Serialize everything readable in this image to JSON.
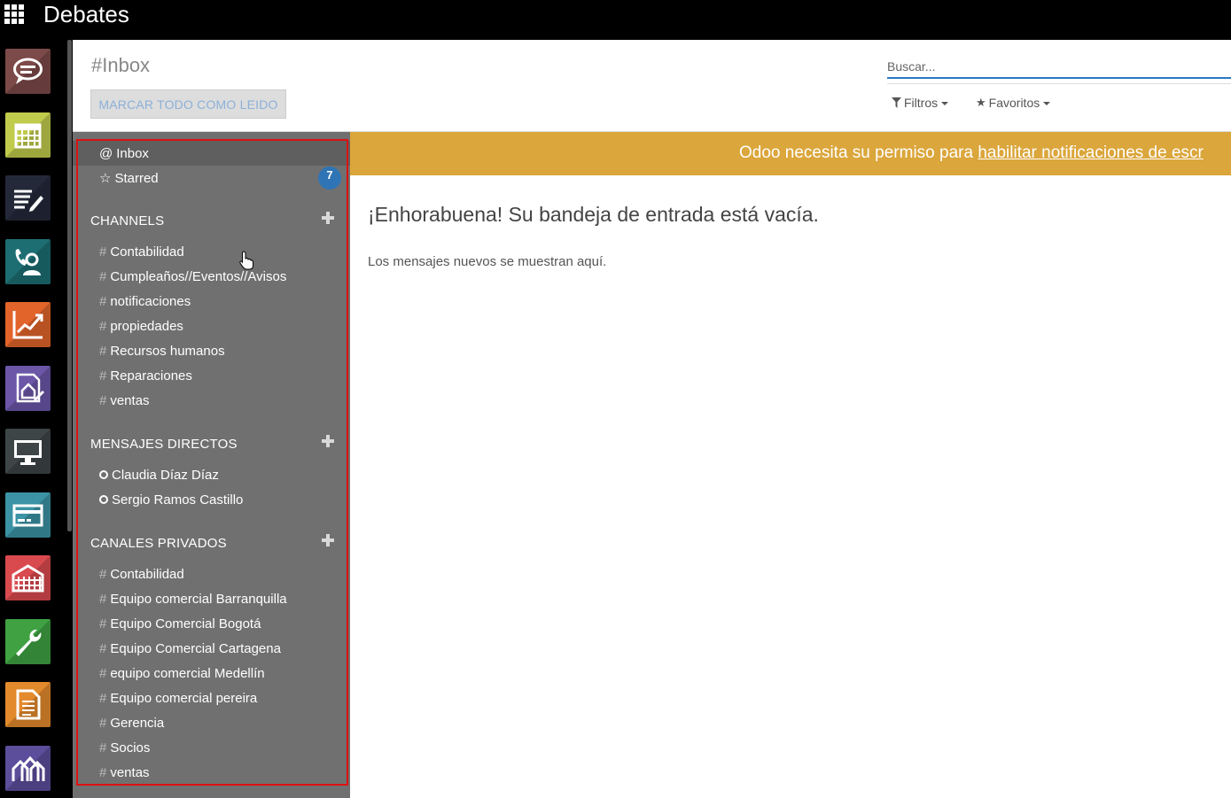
{
  "topbar": {
    "title": "Debates"
  },
  "rail": {
    "apps": [
      {
        "name": "discuss-app",
        "color": "#7c4a48",
        "icon": "chat-bubble-icon"
      },
      {
        "name": "calendar-app",
        "color": "#c1cb4c",
        "icon": "calendar-icon"
      },
      {
        "name": "notes-app",
        "color": "#24293a",
        "icon": "notes-edit-icon"
      },
      {
        "name": "contacts-app",
        "color": "#1d6e73",
        "icon": "contact-phone-icon"
      },
      {
        "name": "crm-app",
        "color": "#e2642b",
        "icon": "trend-chart-icon"
      },
      {
        "name": "property-app",
        "color": "#6b56a8",
        "icon": "house-edit-icon"
      },
      {
        "name": "website-app",
        "color": "#3e4546",
        "icon": "monitor-icon"
      },
      {
        "name": "payments-app",
        "color": "#3c93a5",
        "icon": "credit-card-icon"
      },
      {
        "name": "inventory-app",
        "color": "#d94a4f",
        "icon": "warehouse-icon"
      },
      {
        "name": "settings-app",
        "color": "#3fa142",
        "icon": "wrench-icon"
      },
      {
        "name": "documents-app",
        "color": "#e38a2c",
        "icon": "document-icon"
      },
      {
        "name": "realestate-app",
        "color": "#5c4e9b",
        "icon": "houses-icon"
      }
    ]
  },
  "control": {
    "breadcrumb": "#Inbox",
    "mark_all_read": "MARCAR TODO COMO LEIDO",
    "search_placeholder": "Buscar...",
    "filters": "Filtros",
    "favorites": "Favoritos"
  },
  "sidebar": {
    "inbox": "Inbox",
    "starred": "Starred",
    "starred_count": "7",
    "channels_header": "CHANNELS",
    "channels": [
      "Contabilidad",
      "Cumpleaños//Eventos//Avisos",
      "notificaciones",
      "propiedades",
      "Recursos humanos",
      "Reparaciones",
      "ventas"
    ],
    "dm_header": "MENSAJES DIRECTOS",
    "direct_messages": [
      "Claudia Díaz Díaz",
      "Sergio Ramos Castillo"
    ],
    "private_header": "CANALES PRIVADOS",
    "private_channels": [
      "Contabilidad",
      "Equipo comercial Barranquilla",
      "Equipo Comercial Bogotá",
      "Equipo Comercial Cartagena",
      "equipo comercial Medellín",
      "Equipo comercial pereira",
      "Gerencia",
      "Socios",
      "ventas"
    ]
  },
  "notice": {
    "text": "Odoo necesita su permiso para",
    "link": "habilitar notificaciones de escr"
  },
  "main": {
    "empty_title": "¡Enhorabuena! Su bandeja de entrada está vacía.",
    "empty_subtitle": "Los mensajes nuevos se muestran aquí."
  }
}
